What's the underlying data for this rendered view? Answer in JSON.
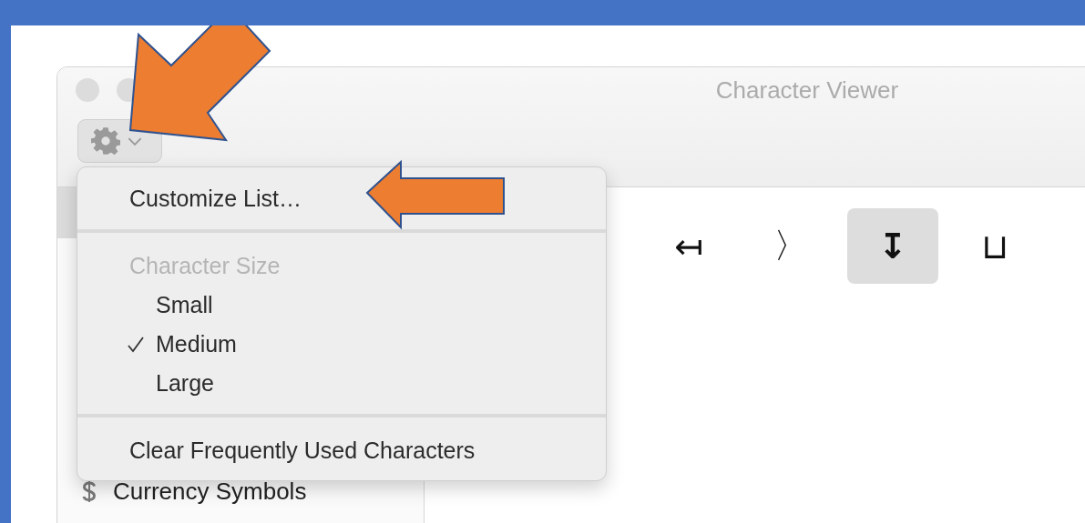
{
  "window": {
    "title": "Character Viewer"
  },
  "toolbar": {
    "action_menu": {
      "expanded": true
    }
  },
  "sidebar": {
    "items": [
      {
        "label": "Currency Symbols",
        "kind": "currency"
      }
    ]
  },
  "characters": [
    {
      "glyph": "↤",
      "selected": false
    },
    {
      "glyph": "〉",
      "selected": false
    },
    {
      "glyph": "↧",
      "selected": true
    },
    {
      "glyph": "⊔",
      "selected": false
    }
  ],
  "menu": {
    "items": [
      {
        "kind": "action",
        "label": "Customize List…"
      },
      {
        "kind": "separator"
      },
      {
        "kind": "header",
        "label": "Character Size"
      },
      {
        "kind": "option",
        "label": "Small",
        "checked": false
      },
      {
        "kind": "option",
        "label": "Medium",
        "checked": true
      },
      {
        "kind": "option",
        "label": "Large",
        "checked": false
      },
      {
        "kind": "separator"
      },
      {
        "kind": "action",
        "label": "Clear Frequently Used Characters"
      }
    ]
  }
}
